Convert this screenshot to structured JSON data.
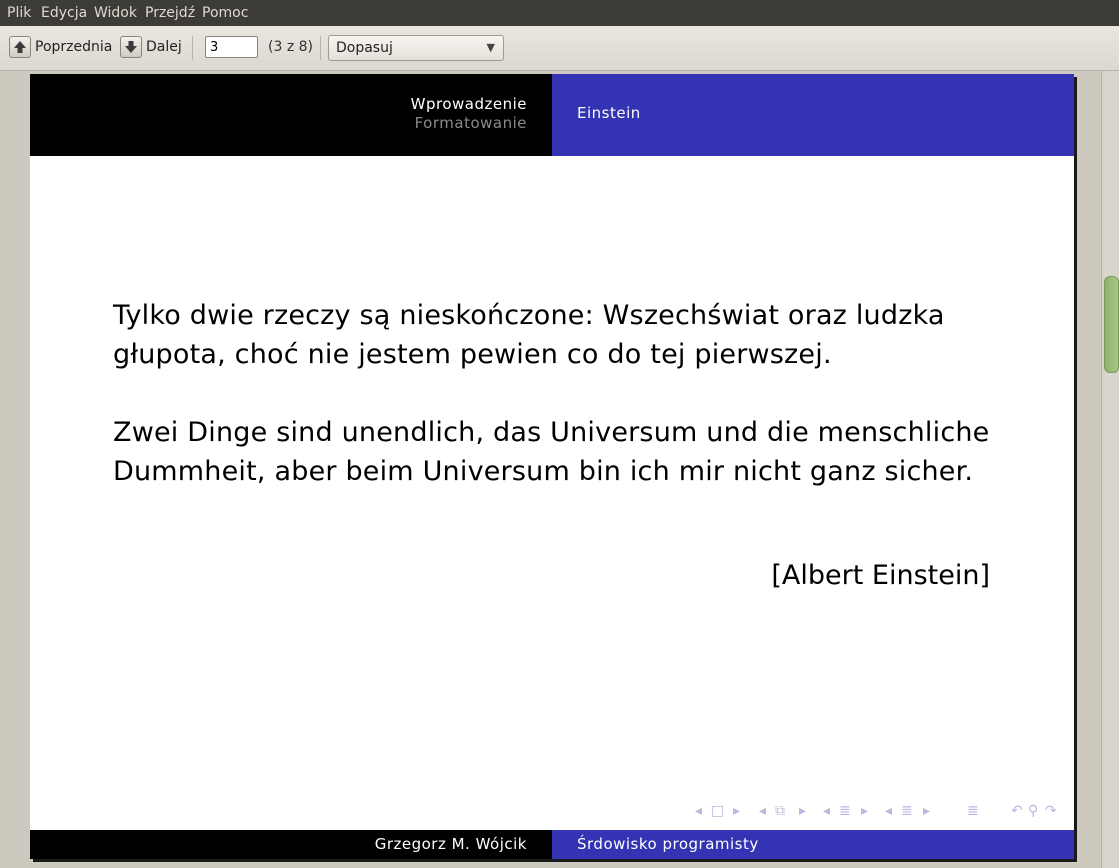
{
  "menu": {
    "items": [
      "Plik",
      "Edycja",
      "Widok",
      "Przejdź",
      "Pomoc"
    ]
  },
  "toolbar": {
    "prev_label": "Poprzednia",
    "next_label": "Dalej",
    "page_value": "3",
    "page_count": "(3 z 8)",
    "zoom_value": "Dopasuj",
    "prev_icon": "arrow-up-icon",
    "next_icon": "arrow-down-icon"
  },
  "slide": {
    "header": {
      "section_current": "Wprowadzenie",
      "section_other": "Formatowanie",
      "frame_title": "Einstein"
    },
    "quote_pl": [
      "Tylko dwie rzeczy są nieskończone: Wszechświat  oraz ludzka",
      "głupota, choć nie jestem pewien  co do tej pierwszej."
    ],
    "quote_de": [
      "Zwei Dinge sind unendlich, das Universum und die  menschliche",
      "Dummheit, aber beim Universum bin  ich mir nicht ganz sicher."
    ],
    "author": "[Albert Einstein]",
    "footer": {
      "author": "Grzegorz M. Wójcik",
      "title": "Śrdowisko programisty"
    }
  },
  "colors": {
    "header_left": "#000000",
    "header_right": "#3333b3",
    "menubar": "#3c3b37",
    "window_bg": "#cec9bf"
  }
}
